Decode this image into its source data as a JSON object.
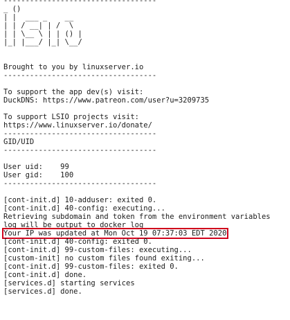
{
  "console": {
    "lines": [
      "-----------------------------------",
      "_ ()",
      "| |  ___ _    __",
      "| | / __| | /  \\",
      "| | \\__ \\ | | () |",
      "|_| |___/ |_| \\__/",
      "",
      "",
      "Brought to you by linuxserver.io",
      "-----------------------------------",
      "",
      "To support the app dev(s) visit:",
      "DuckDNS: https://www.patreon.com/user?u=3209735",
      "",
      "To support LSIO projects visit:",
      "https://www.linuxserver.io/donate/",
      "-----------------------------------",
      "GID/UID",
      "-----------------------------------",
      "",
      "User uid:    99",
      "User gid:    100",
      "-----------------------------------",
      "",
      "[cont-init.d] 10-adduser: exited 0.",
      "[cont-init.d] 40-config: executing...",
      "Retrieving subdomain and token from the environment variables",
      "log will be output to docker log",
      "Your IP was updated at Mon Oct 19 07:37:03 EDT 2020",
      "[cont-init.d] 40-config: exited 0.",
      "[cont-init.d] 99-custom-files: executing...",
      "[custom-init] no custom files found exiting...",
      "[cont-init.d] 99-custom-files: exited 0.",
      "[cont-init.d] done.",
      "[services.d] starting services",
      "[services.d] done."
    ],
    "highlighted_line_index": 28,
    "highlight_color": "#d0021b",
    "text_color": "#1a1a1a",
    "background_color": "#ffffff"
  }
}
